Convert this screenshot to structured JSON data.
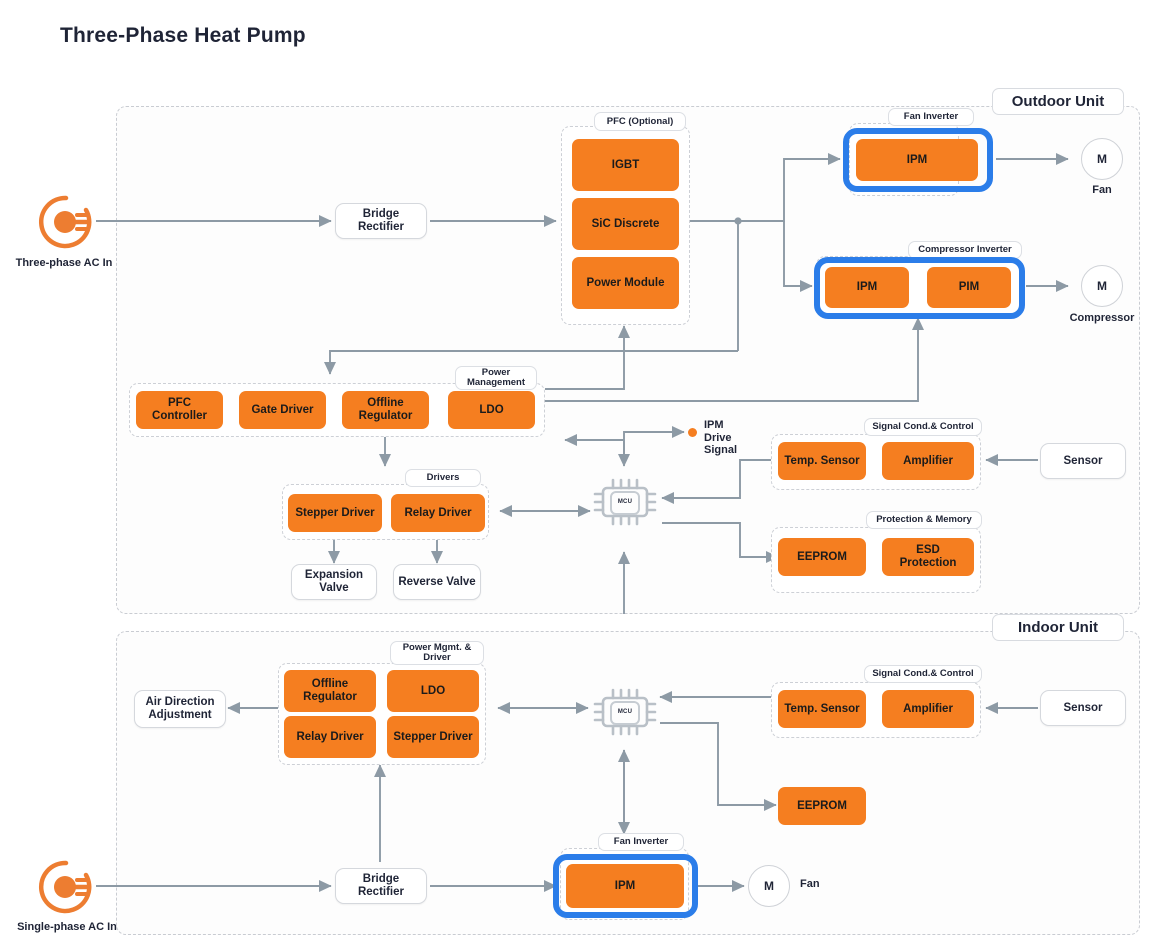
{
  "title": "Three-Phase Heat Pump",
  "colors": {
    "accent_orange": "#F57E20",
    "highlight_blue": "#2B7DE9",
    "wire": "#8d9aa5",
    "text": "#1f2436"
  },
  "units": {
    "outdoor": {
      "label": "Outdoor Unit"
    },
    "indoor": {
      "label": "Indoor Unit"
    }
  },
  "sources": {
    "three_phase": {
      "icon": "power-plug-icon",
      "caption": "Three-phase AC In"
    },
    "single_phase": {
      "icon": "power-plug-icon",
      "caption": "Single-phase AC In"
    }
  },
  "outdoor": {
    "bridge_rectifier": "Bridge\nRectifier",
    "bridge_rectifier_l1": "Bridge",
    "bridge_rectifier_l2": "Rectifier",
    "pfc": {
      "label": "PFC (Optional)",
      "blocks": [
        "IGBT",
        "SiC Discrete",
        "Power Module"
      ]
    },
    "fan_inverter": {
      "label": "Fan Inverter",
      "blocks": [
        "IPM"
      ],
      "highlighted": true
    },
    "compressor_inverter": {
      "label": "Compressor Inverter",
      "blocks": [
        "IPM",
        "PIM"
      ],
      "highlighted": true
    },
    "motors": [
      {
        "symbol": "M",
        "caption": "Fan"
      },
      {
        "symbol": "M",
        "caption": "Compressor"
      }
    ],
    "power_management": {
      "label": "Power\nManagement",
      "label_l1": "Power",
      "label_l2": "Management",
      "blocks": [
        "PFC Controller",
        "Gate Driver",
        "Offline\nRegulator",
        "LDO"
      ],
      "block_offline_l1": "Offline",
      "block_offline_l2": "Regulator"
    },
    "drivers": {
      "label": "Drivers",
      "blocks": [
        "Stepper Driver",
        "Relay Driver"
      ]
    },
    "valves": [
      {
        "l1": "Expansion",
        "l2": "Valve"
      },
      {
        "l1": "Reverse Valve",
        "l2": ""
      }
    ],
    "mcu": {
      "label": "MCU",
      "icon": "mcu-chip-icon"
    },
    "ipm_drive_signal": {
      "l1": "IPM",
      "l2": "Drive",
      "l3": "Signal",
      "dot": "orange-dot-icon"
    },
    "signal_cond": {
      "label": "Signal Cond.& Control",
      "blocks": [
        "Temp. Sensor",
        "Amplifier"
      ]
    },
    "protection_memory": {
      "label": "Protection & Memory",
      "blocks": [
        "EEPROM",
        "ESD\nProtection"
      ],
      "block_esd_l1": "ESD",
      "block_esd_l2": "Protection"
    },
    "sensor": "Sensor"
  },
  "indoor": {
    "bridge_rectifier_l1": "Bridge",
    "bridge_rectifier_l2": "Rectifier",
    "power_mgmt_driver": {
      "label_l1": "Power Mgmt. &",
      "label_l2": "Driver",
      "blocks": [
        "Offline\nRegulator",
        "LDO",
        "Relay Driver",
        "Stepper Driver"
      ],
      "block_offline_l1": "Offline",
      "block_offline_l2": "Regulator"
    },
    "air_direction": {
      "l1": "Air Direction",
      "l2": "Adjustment"
    },
    "mcu": {
      "label": "MCU",
      "icon": "mcu-chip-icon"
    },
    "signal_cond": {
      "label": "Signal Cond.& Control",
      "blocks": [
        "Temp. Sensor",
        "Amplifier"
      ]
    },
    "eeprom": "EEPROM",
    "sensor": "Sensor",
    "fan_inverter": {
      "label": "Fan Inverter",
      "blocks": [
        "IPM"
      ],
      "highlighted": true
    },
    "motor": {
      "symbol": "M",
      "caption": "Fan"
    }
  }
}
